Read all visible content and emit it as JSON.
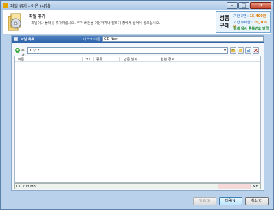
{
  "window": {
    "title": "파일 굽기 - 이온 (시험)",
    "min_glyph": "–",
    "max_glyph": "□",
    "close_glyph": "✕"
  },
  "header": {
    "title": "파일 추가",
    "description": "- 파일이나 폴더를 추가하십시오. 추가 버튼을 이용하거나 탐색기 창에서 끌어서 놓으십시오."
  },
  "promo": {
    "badge_line1": "정품",
    "badge_line2": "구매",
    "line1_label": "기한 3년 : ",
    "line1_price": "15,400원",
    "line2_label": "기한 무제한 : ",
    "line2_price": "29,700원",
    "line3": "결제 즉시 등록번호 발급",
    "colors": {
      "blue": "#1f5fb8",
      "orange": "#e07a00",
      "green": "#1d8a2c"
    }
  },
  "panel": {
    "title": "파일 목록",
    "disc_name_label": "디스크 이름",
    "disc_name_value": "CD New"
  },
  "toolbar": {
    "add_label": "추가",
    "path_value": "C:\\*.*",
    "icons": [
      "folder-up-icon",
      "new-folder-icon",
      "view-icon",
      "delete-icon"
    ]
  },
  "list": {
    "columns": [
      "이름",
      "크기",
      "종류",
      "만든 날짜",
      "원본 경로"
    ],
    "rows": []
  },
  "capacity": {
    "label": "CD 703 MB",
    "max_label": "1 MB"
  },
  "footer": {
    "back": "뒤로(B)",
    "next": "다음(N)",
    "cancel": "취소(C)"
  }
}
